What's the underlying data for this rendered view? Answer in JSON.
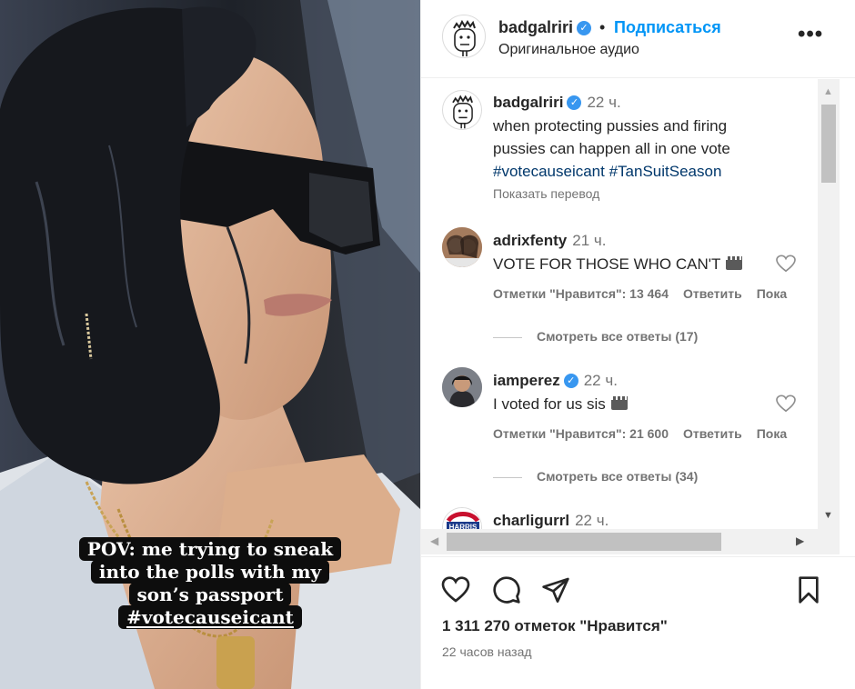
{
  "media": {
    "caption_lines": [
      "POV: me trying to sneak",
      "into the polls with my",
      "son’s passport"
    ],
    "caption_tag": "#votecauseicant"
  },
  "header": {
    "username": "badgalriri",
    "separator": "•",
    "follow_label": "Подписаться",
    "audio_label": "Оригинальное аудио",
    "more_label": "•••"
  },
  "post": {
    "username": "badgalriri",
    "time": "22 ч.",
    "text_lines": [
      "when protecting pussies and firing",
      "pussies can happen all in one vote"
    ],
    "hashtags": "#votecauseicant #TanSuitSeason",
    "translate_label": "Показать перевод"
  },
  "comments": [
    {
      "username": "adrixfenty",
      "time": "21 ч.",
      "text": "VOTE FOR THOSE WHO CAN'T",
      "likes": "Отметки \"Нравится\": 13 464",
      "reply": "Ответить",
      "extra": "Пока",
      "view_replies": "Смотреть все ответы (17)"
    },
    {
      "username": "iamperez",
      "time": "22 ч.",
      "text": "I voted for us sis",
      "likes": "Отметки \"Нравится\": 21 600",
      "reply": "Ответить",
      "extra": "Пока",
      "view_replies": "Смотреть все ответы (34)"
    },
    {
      "username": "charligurrl",
      "time": "22 ч.",
      "avatar_text": "HARRIS"
    }
  ],
  "footer": {
    "likes_label": "1 311 270 отметок \"Нравится\"",
    "time_ago": "22 часов назад"
  },
  "colors": {
    "link_blue": "#0095f6",
    "hashtag": "#00376b",
    "verified": "#3897f0"
  }
}
